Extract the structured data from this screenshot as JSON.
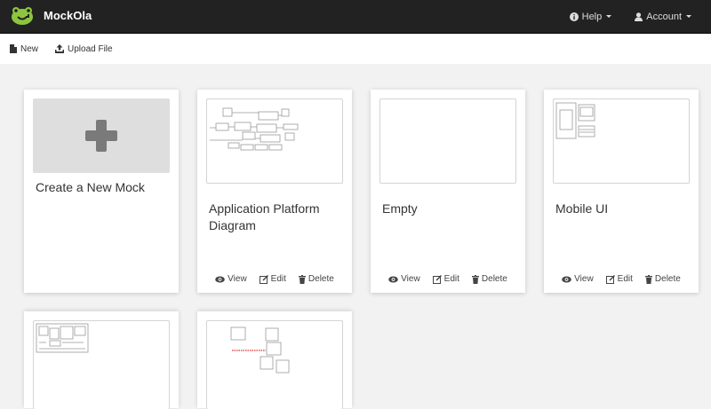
{
  "app": {
    "brand": "MockOla",
    "nav": {
      "help": "Help",
      "account": "Account"
    },
    "toolbar": {
      "new": "New",
      "upload": "Upload File"
    }
  },
  "cards": [
    {
      "title": "Create a New Mock"
    },
    {
      "title": "Application Platform Diagram",
      "view": "View",
      "edit": "Edit",
      "delete": "Delete"
    },
    {
      "title": "Empty",
      "view": "View",
      "edit": "Edit",
      "delete": "Delete"
    },
    {
      "title": "Mobile UI",
      "view": "View",
      "edit": "Edit",
      "delete": "Delete"
    }
  ],
  "colors": {
    "navbar": "#222222",
    "brand_green": "#8cc63f",
    "create_tile": "#dedede",
    "plus": "#7a7a7a"
  },
  "icons": [
    "mockola-logo-icon",
    "info-icon",
    "user-icon",
    "file-icon",
    "upload-icon",
    "eye-icon",
    "edit-icon",
    "trash-icon",
    "plus-icon"
  ]
}
